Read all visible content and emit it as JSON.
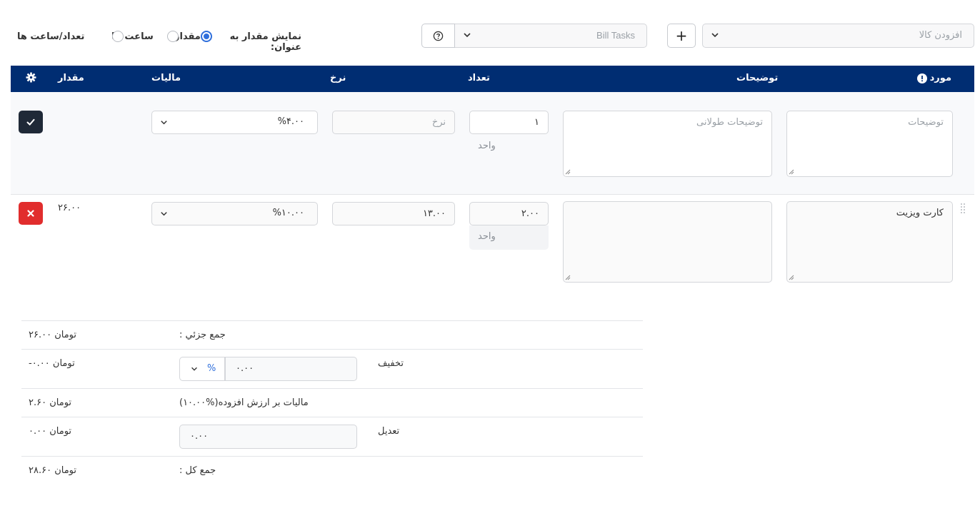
{
  "toolbar": {
    "add_item_placeholder": "افزودن کالا",
    "add_button_label": "+",
    "bill_tasks_placeholder": "Bill Tasks",
    "display_as_label": "نمایش مقدار به عنوان:",
    "radio_options": [
      {
        "label": "مقدار",
        "selected": true
      },
      {
        "label": "ساعت ها",
        "selected": false
      },
      {
        "label": "تعداد/ساعت ها",
        "selected": false
      }
    ]
  },
  "table": {
    "headers": {
      "item": "مورد",
      "description": "توضیحات",
      "qty": "تعداد",
      "rate": "نرخ",
      "tax": "مالیات",
      "amount": "مقدار"
    },
    "new_row": {
      "item_placeholder": "توضیحات",
      "long_desc_placeholder": "توضیحات طولانی",
      "qty_value": "۱",
      "unit_placeholder": "واحد",
      "rate_placeholder": "نرخ",
      "tax_value": "%۴.۰۰"
    },
    "rows": [
      {
        "item": "کارت ویزیت",
        "description": "",
        "qty": "۲.۰۰",
        "unit": "واحد",
        "rate": "۱۳.۰۰",
        "tax": "%۱۰.۰۰",
        "amount": "۲۶.۰۰"
      }
    ]
  },
  "totals": {
    "subtotal_label": "جمع جزئي :",
    "subtotal_value": "۲۶.۰۰ تومان",
    "discount_label": "تخفیف",
    "discount_input": "۰.۰۰",
    "discount_type": "%",
    "discount_value": "-۰.۰۰ تومان",
    "vat_label": "مالیات بر ارزش افزوده(%۱۰.۰۰)",
    "vat_value": "۲.۶۰ تومان",
    "adjustment_label": "تعدیل",
    "adjustment_input": "۰.۰۰",
    "adjustment_value": "۰.۰۰ تومان",
    "total_label": "جمع کل :",
    "total_value": "۲۸.۶۰ تومان"
  },
  "colors": {
    "header_bg": "#002d72",
    "accent": "#2f6fdc",
    "confirm_button": "#1f2937",
    "delete_button": "#e12d2d"
  },
  "icons": {
    "check": "check-icon",
    "delete": "close-icon",
    "settings": "gear-icon",
    "help": "question-circle-icon",
    "info": "exclamation-circle-icon",
    "dropdown": "chevron-down-icon",
    "drag": "drag-handle-icon"
  }
}
